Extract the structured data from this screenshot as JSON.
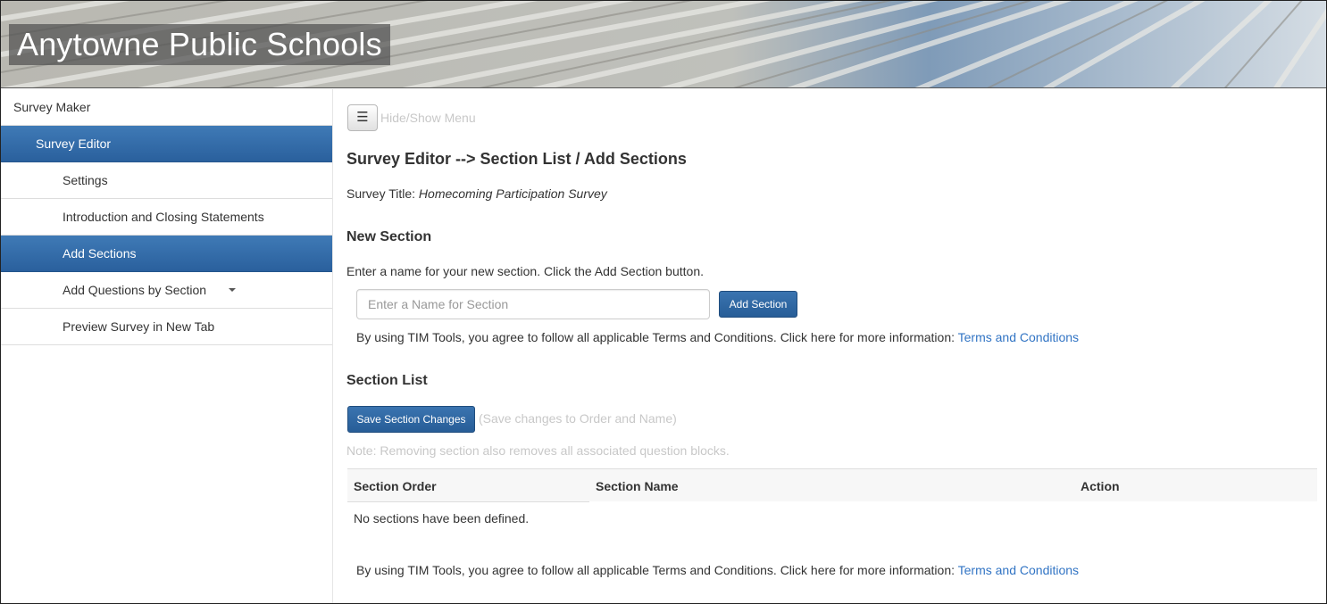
{
  "header": {
    "title": "Anytowne Public Schools"
  },
  "sidebar": {
    "items": [
      {
        "label": "Survey Maker",
        "level": 0,
        "active": false
      },
      {
        "label": "Survey Editor",
        "level": 1,
        "active": true
      },
      {
        "label": "Settings",
        "level": 2,
        "active": false
      },
      {
        "label": "Introduction and Closing Statements",
        "level": 2,
        "active": false
      },
      {
        "label": "Add Sections",
        "level": 2,
        "active": true
      },
      {
        "label": "Add Questions by Section",
        "level": 2,
        "active": false,
        "has_dropdown": true
      },
      {
        "label": "Preview Survey in New Tab",
        "level": 2,
        "active": false
      }
    ]
  },
  "main": {
    "menu_toggle_icon": "hamburger-icon",
    "menu_toggle_glyph": "☰",
    "menu_hint": "Hide/Show Menu",
    "page_title": "Survey Editor --> Section List / Add Sections",
    "survey_title_label": "Survey Title:",
    "survey_title_value": "Homecoming Participation Survey",
    "new_section": {
      "heading": "New Section",
      "instructions": "Enter a name for your new section. Click the Add Section button.",
      "input_value": "",
      "input_placeholder": "Enter a Name for Section",
      "add_button_label": "Add Section"
    },
    "terms": {
      "text": "By using TIM Tools, you agree to follow all applicable Terms and Conditions. Click here for more information:",
      "link_label": "Terms and Conditions"
    },
    "section_list": {
      "heading": "Section List",
      "save_button_label": "Save Section Changes",
      "save_hint": "(Save changes to Order and Name)",
      "note": "Note: Removing section also removes all associated question blocks.",
      "columns": [
        "Section Order",
        "Section Name",
        "Action"
      ],
      "empty_message": "No sections have been defined."
    }
  },
  "colors": {
    "accent": "#2d649f",
    "link": "#3174c4",
    "muted": "#c8c8c8"
  }
}
